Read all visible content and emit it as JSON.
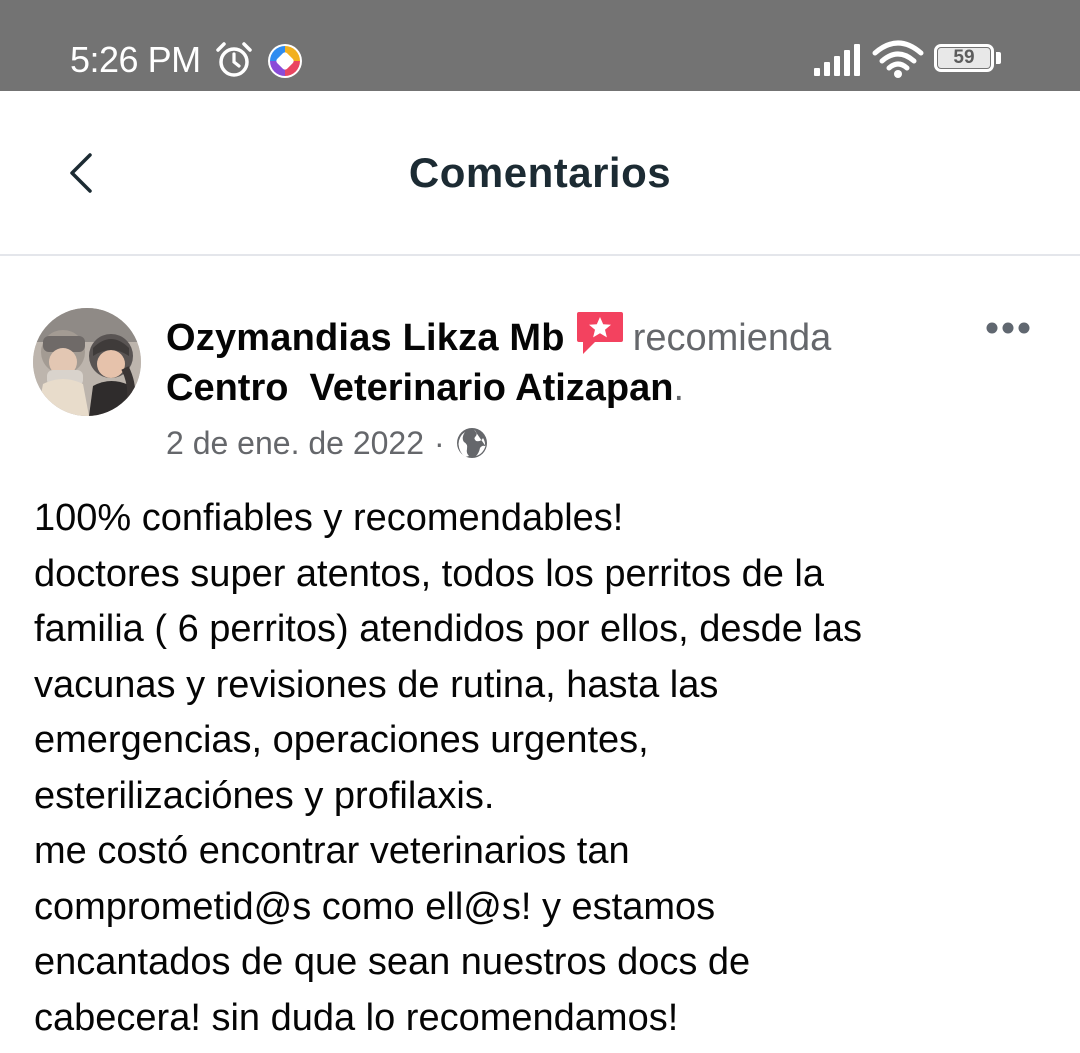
{
  "status_bar": {
    "time": "5:26 PM",
    "battery_level": "59",
    "icons": [
      "alarm-icon",
      "app-notification-icon",
      "signal-icon",
      "wifi-icon",
      "battery-icon"
    ]
  },
  "header": {
    "title": "Comentarios",
    "back_icon": "chevron-left-icon"
  },
  "post": {
    "author": "Ozymandias Likza Mb",
    "recommend_icon": "recommend-star-icon",
    "recommend_word": "recomienda",
    "page_name": "Centro  Veterinario Atizapan",
    "period": ".",
    "date": "2 de ene. de 2022",
    "meta_separator": "·",
    "privacy_icon": "globe-icon",
    "more_icon": "more-dots-icon",
    "body_lines": [
      "100% confiables y recomendables!",
      "doctores super atentos, todos los perritos de la",
      "familia ( 6 perritos) atendidos por ellos, desde las",
      "vacunas y revisiones de rutina, hasta las",
      "emergencias, operaciones urgentes,",
      "esterilizaciónes y profilaxis.",
      "me costó encontrar veterinarios tan",
      "comprometid@s como ell@s! y estamos",
      "encantados de que sean nuestros docs de",
      "cabecera! sin duda lo recomendamos!"
    ]
  },
  "colors": {
    "status_bar_bg": "#737373",
    "title_text": "#1c2b33",
    "primary_text": "#050505",
    "secondary_text": "#65676b",
    "recommend_red": "#f3425f",
    "divider": "#e4e6eb"
  }
}
